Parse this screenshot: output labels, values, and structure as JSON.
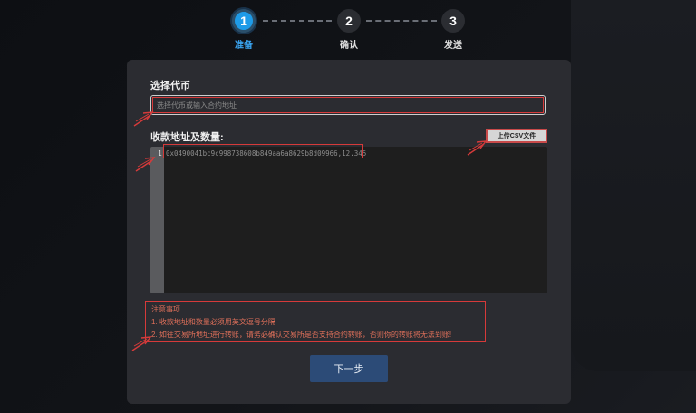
{
  "steps": [
    {
      "number": "1",
      "label": "准备",
      "state": "active"
    },
    {
      "number": "2",
      "label": "确认",
      "state": "inactive"
    },
    {
      "number": "3",
      "label": "发送",
      "state": "inactive"
    }
  ],
  "form": {
    "token_label": "选择代币",
    "token_placeholder": "选择代币或输入合约地址",
    "recipients_label": "收款地址及数量:",
    "upload_button": "上传CSV文件",
    "editor": {
      "line_number": "1",
      "line_text": "0x0490041bc9c998738608b849aa6a8629b8d09966,12.345"
    },
    "notes": {
      "title": "注意事项",
      "items": [
        "1. 收款地址和数量必须用英文逗号分隔",
        "2. 如往交易所地址进行转账，请务必确认交易所是否支持合约转账，否则你的转账将无法到账!"
      ]
    },
    "next_button": "下一步"
  },
  "colors": {
    "accent": "#1e9be8",
    "annotation_red": "#d63a3a",
    "primary_button": "#2c4b77",
    "card_bg": "#2b2c31"
  }
}
